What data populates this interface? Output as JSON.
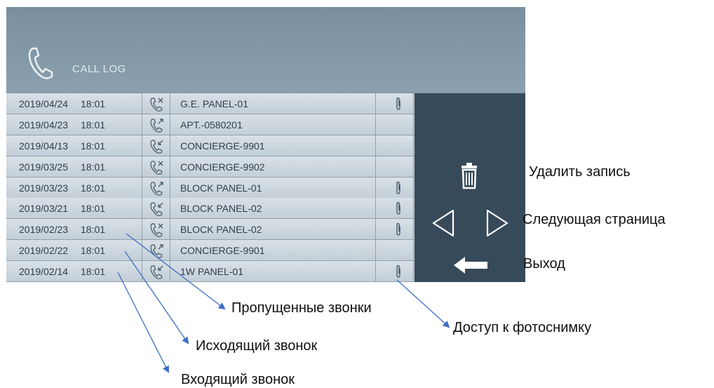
{
  "header": {
    "title": "CALL LOG",
    "icon": "phone-handset-icon"
  },
  "log": {
    "rows": [
      {
        "date": "2019/04/24",
        "time": "18:01",
        "type": "missed",
        "type_icon": "missed-call-icon",
        "name": "G.E. PANEL-01",
        "has_photo": true
      },
      {
        "date": "2019/04/23",
        "time": "18:01",
        "type": "outgoing",
        "type_icon": "outgoing-call-icon",
        "name": "APT.-0580201",
        "has_photo": false
      },
      {
        "date": "2019/04/13",
        "time": "18:01",
        "type": "incoming",
        "type_icon": "incoming-call-icon",
        "name": "CONCIERGE-9901",
        "has_photo": false
      },
      {
        "date": "2019/03/25",
        "time": "18:01",
        "type": "missed",
        "type_icon": "missed-call-icon",
        "name": "CONCIERGE-9902",
        "has_photo": false
      },
      {
        "date": "2019/03/23",
        "time": "18:01",
        "type": "outgoing",
        "type_icon": "outgoing-call-icon",
        "name": "BLOCK PANEL-01",
        "has_photo": true
      },
      {
        "date": "2019/03/21",
        "time": "18:01",
        "type": "incoming",
        "type_icon": "incoming-call-icon",
        "name": "BLOCK PANEL-02",
        "has_photo": true
      },
      {
        "date": "2019/02/23",
        "time": "18:01",
        "type": "missed",
        "type_icon": "missed-call-icon",
        "name": "BLOCK PANEL-02",
        "has_photo": true
      },
      {
        "date": "2019/02/22",
        "time": "18:01",
        "type": "outgoing",
        "type_icon": "outgoing-call-icon",
        "name": "CONCIERGE-9901",
        "has_photo": false
      },
      {
        "date": "2019/02/14",
        "time": "18:01",
        "type": "incoming",
        "type_icon": "incoming-call-icon",
        "name": "1W PANEL-01",
        "has_photo": true
      }
    ]
  },
  "side_panel": {
    "delete_icon": "trash-icon",
    "prev_icon": "triangle-left-icon",
    "next_icon": "triangle-right-icon",
    "exit_icon": "arrow-left-icon"
  },
  "annotations": {
    "delete": "Удалить запись",
    "next_page": "Следующая страница",
    "exit": "Выход",
    "missed": "Пропущенные звонки",
    "photo": "Доступ к фотоснимку",
    "outgoing": "Исходящий звонок",
    "incoming": "Входящий звонок"
  },
  "colors": {
    "header_bg": "#7d93a3",
    "panel_bg": "#374a5a",
    "row_bg": "#d3dce3",
    "text": "#2f3e4c",
    "arrow": "#3d6fc4"
  }
}
